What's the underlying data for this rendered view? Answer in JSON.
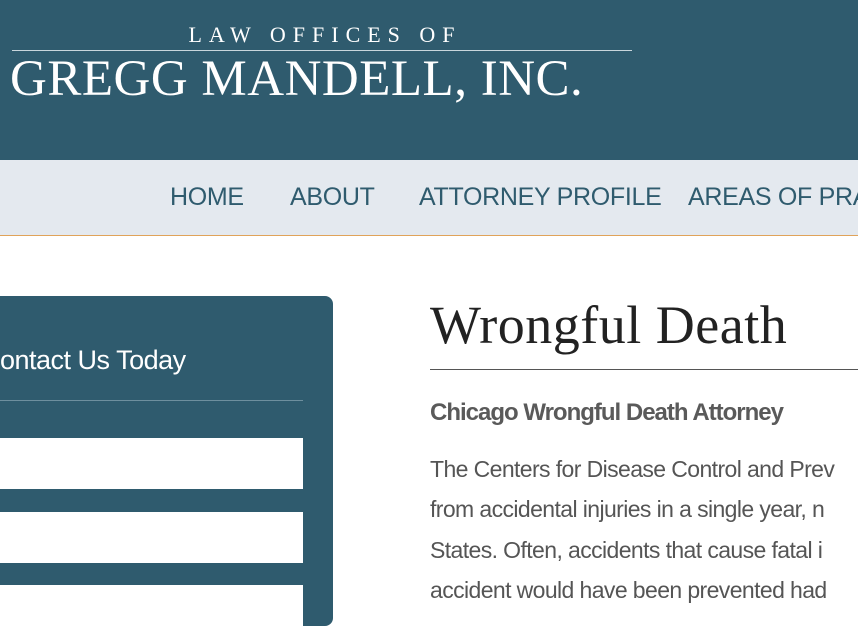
{
  "header": {
    "logo_top": "LAW OFFICES OF",
    "logo_main": "GREGG MANDELL, INC."
  },
  "nav": {
    "items": [
      {
        "label": "HOME"
      },
      {
        "label": "ABOUT"
      },
      {
        "label": "ATTORNEY PROFILE"
      },
      {
        "label": "AREAS OF PRAC"
      }
    ]
  },
  "sidebar": {
    "title": "ontact Us Today",
    "fields": [
      {
        "value": ""
      },
      {
        "value": ""
      },
      {
        "value": ""
      }
    ]
  },
  "main": {
    "title": "Wrongful Death",
    "subheading": "Chicago Wrongful Death Attorney",
    "paragraph_lines": [
      "The Centers for Disease Control and Prev",
      "from accidental injuries in a single year, n",
      "States. Often, accidents that cause fatal i",
      "accident would have been prevented had"
    ]
  },
  "colors": {
    "header_bg": "#2f5b6e",
    "nav_bg": "#e4e9ef",
    "nav_text": "#2f5b6e",
    "nav_border": "#e0a35a",
    "sidebar_bg": "#2f5b6e"
  }
}
